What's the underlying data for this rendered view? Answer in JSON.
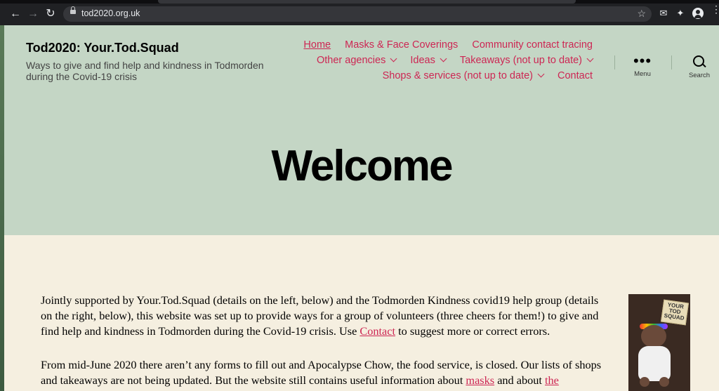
{
  "browser": {
    "url": "tod2020.org.uk"
  },
  "site": {
    "title": "Tod2020: Your.Tod.Squad",
    "description": "Ways to give and find help and kindness in Todmorden during the Covid-19 crisis"
  },
  "nav": {
    "row1": [
      "Home",
      "Masks & Face Coverings",
      "Community contact tracing"
    ],
    "row2": [
      "Other agencies",
      "Ideas",
      "Takeaways (not up to date)"
    ],
    "row3": [
      "Shops & services (not up to date)",
      "Contact"
    ]
  },
  "tools": {
    "menu_label": "Menu",
    "search_label": "Search"
  },
  "page": {
    "title": "Welcome",
    "p1_before": "Jointly supported by Your.Tod.Squad (details on the left, below) and the Todmorden Kindness covid19 help group (details on the right, below), this website was set up to provide ways for a group of volunteers (three cheers for them!) to give and find help and kindness in Todmorden during the Covid-19 crisis. Use ",
    "p1_link": "Contact",
    "p1_after": " to suggest more or correct errors.",
    "p2_before": "From mid-June 2020 there aren’t any forms to fill out and Apocalypse Chow, the food service, is closed. Our lists of shops and takeaways are not being updated. But the website still contains useful information about ",
    "p2_link1": "masks",
    "p2_mid": " and about ",
    "p2_link2": "the"
  },
  "image": {
    "sign_text": "YOUR TOD SQUAD"
  }
}
